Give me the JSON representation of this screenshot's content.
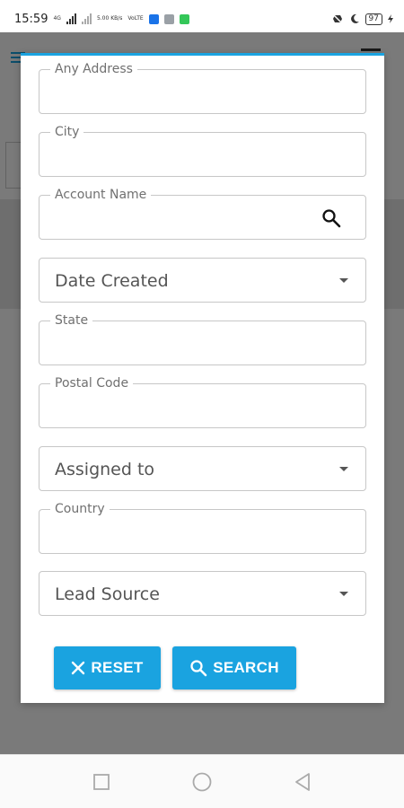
{
  "status_bar": {
    "time": "15:59",
    "net_label_1": "4G",
    "net_label_2": "5.00 KB/s",
    "net_label_3": "VoLTE",
    "battery": "97"
  },
  "dialog": {
    "fields": [
      {
        "label": "Any Address",
        "value": ""
      },
      {
        "label": "City",
        "value": ""
      },
      {
        "label": "Account Name",
        "value": ""
      },
      {
        "label": "",
        "value": "Date Created"
      },
      {
        "label": "State",
        "value": ""
      },
      {
        "label": "Postal Code",
        "value": ""
      },
      {
        "label": "",
        "value": "Assigned to"
      },
      {
        "label": "Country",
        "value": ""
      },
      {
        "label": "",
        "value": "Lead Source"
      }
    ],
    "reset_label": "RESET",
    "search_label": "SEARCH"
  },
  "colors": {
    "accent": "#1aa3e0",
    "overlay": "rgba(0,0,0,0.52)"
  },
  "icons": {
    "search": "search-icon",
    "close": "close-icon",
    "dropdown": "chevron-down-icon",
    "nav_recents": "square-icon",
    "nav_home": "circle-icon",
    "nav_back": "triangle-back-icon"
  }
}
